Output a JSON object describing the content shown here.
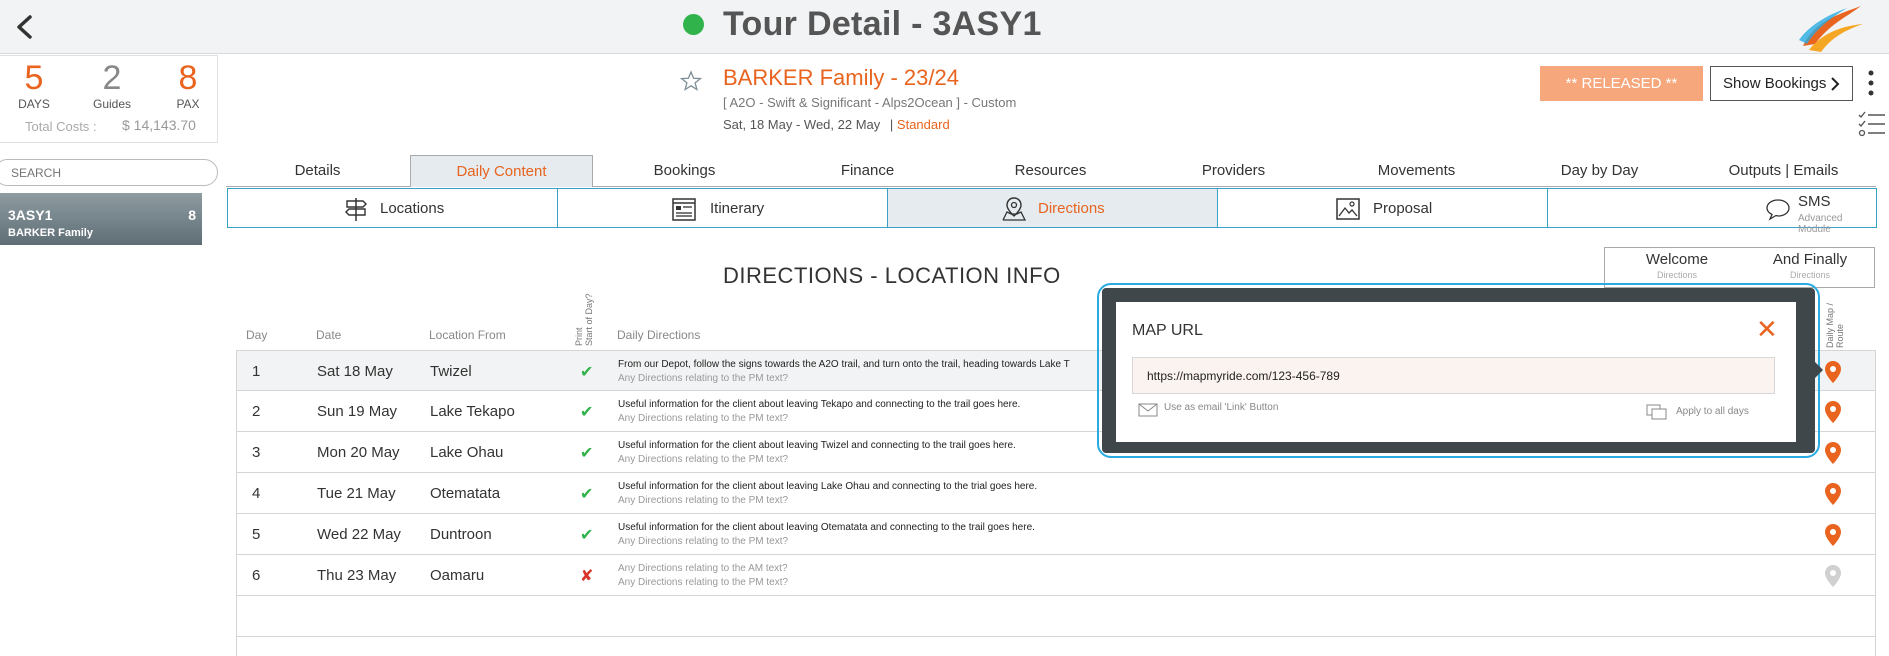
{
  "header": {
    "title": "Tour Detail - 3ASY1",
    "status_color": "#2fb34a"
  },
  "summary": {
    "days_value": "5",
    "days_label": "DAYS",
    "guides_value": "2",
    "guides_label": "Guides",
    "pax_value": "8",
    "pax_label": "PAX",
    "total_costs_label": "Total Costs :",
    "total_costs_value": "$ 14,143.70"
  },
  "search": {
    "placeholder": "SEARCH"
  },
  "tour_list": [
    {
      "code": "3ASY1",
      "count": "8",
      "name": "BARKER Family"
    }
  ],
  "tour": {
    "name": "BARKER Family - 23/24",
    "subtitle": "[ A2O - Swift & Significant - Alps2Ocean ] - Custom",
    "dates": "Sat, 18 May  - Wed, 22 May",
    "separator": "|",
    "type": "Standard"
  },
  "actions": {
    "released_label": "** RELEASED **",
    "show_bookings_label": "Show Bookings"
  },
  "main_tabs": [
    "Details",
    "Daily Content",
    "Bookings",
    "Finance",
    "Resources",
    "Providers",
    "Movements",
    "Day by Day",
    "Outputs | Emails"
  ],
  "sub_tabs": [
    {
      "label": "Locations",
      "icon": "signpost-icon"
    },
    {
      "label": "Itinerary",
      "icon": "itinerary-icon"
    },
    {
      "label": "Directions",
      "icon": "map-pin-icon"
    },
    {
      "label": "Proposal",
      "icon": "image-icon"
    },
    {
      "label": "SMS",
      "sublabel": "Advanced Module",
      "icon": "chat-bubble-icon"
    }
  ],
  "extra_tabs": [
    {
      "label": "Welcome",
      "sublabel": "Directions"
    },
    {
      "label": "And Finally",
      "sublabel": "Directions"
    }
  ],
  "section_title": "DIRECTIONS - LOCATION INFO",
  "table": {
    "headers": {
      "day": "Day",
      "date": "Date",
      "location_from": "Location From",
      "print_start_1": "Print",
      "print_start_2": "Start of Day?",
      "daily_directions": "Daily Directions",
      "map_1": "Daily Map /",
      "map_2": "Route"
    },
    "rows": [
      {
        "day": "1",
        "date": "Sat 18 May",
        "location": "Twizel",
        "print": "✔",
        "dir_am": "From our Depot, follow the signs towards the A2O trail, and turn onto the trail, heading towards Lake T",
        "dir_pm": "Any Directions relating to the PM text?",
        "pin_color": "#e8641f"
      },
      {
        "day": "2",
        "date": "Sun 19 May",
        "location": "Lake Tekapo",
        "print": "✔",
        "dir_am": "Useful information for the client about leaving Tekapo and connecting to the trail goes here.",
        "dir_pm": "Any Directions relating to the PM text?",
        "pin_color": "#e8641f"
      },
      {
        "day": "3",
        "date": "Mon 20 May",
        "location": "Lake Ohau",
        "print": "✔",
        "dir_am": "Useful information for the client about leaving Twizel and connecting to the trail goes here.",
        "dir_pm": "Any Directions relating to the PM text?",
        "pin_color": "#e8641f"
      },
      {
        "day": "4",
        "date": "Tue 21 May",
        "location": "Otematata",
        "print": "✔",
        "dir_am": "Useful information for the client about leaving Lake Ohau and connecting to the trial goes here.",
        "dir_pm": "Any Directions relating to the PM text?",
        "pin_color": "#e8641f"
      },
      {
        "day": "5",
        "date": "Wed 22 May",
        "location": "Duntroon",
        "print": "✔",
        "dir_am": "Useful information for the client about leaving Otematata and connecting to the trail goes here.",
        "dir_pm": "Any Directions relating to the PM text?",
        "pin_color": "#e8641f"
      },
      {
        "day": "6",
        "date": "Thu 23 May",
        "location": "Oamaru",
        "print": "✘",
        "dir_am": "Any Directions relating to the AM text?",
        "dir_pm": "Any Directions relating to the PM text?",
        "pin_color": "#d0d0d0"
      }
    ]
  },
  "modal": {
    "title": "MAP URL",
    "url_value": "https://mapmyride.com/123-456-789",
    "email_link_label": "Use as email 'Link' Button",
    "apply_all_label": "Apply to all days"
  },
  "colors": {
    "accent": "#e8641f",
    "check": "#2fb34a",
    "cross": "#d9342b",
    "modal_border": "#29abe2"
  }
}
